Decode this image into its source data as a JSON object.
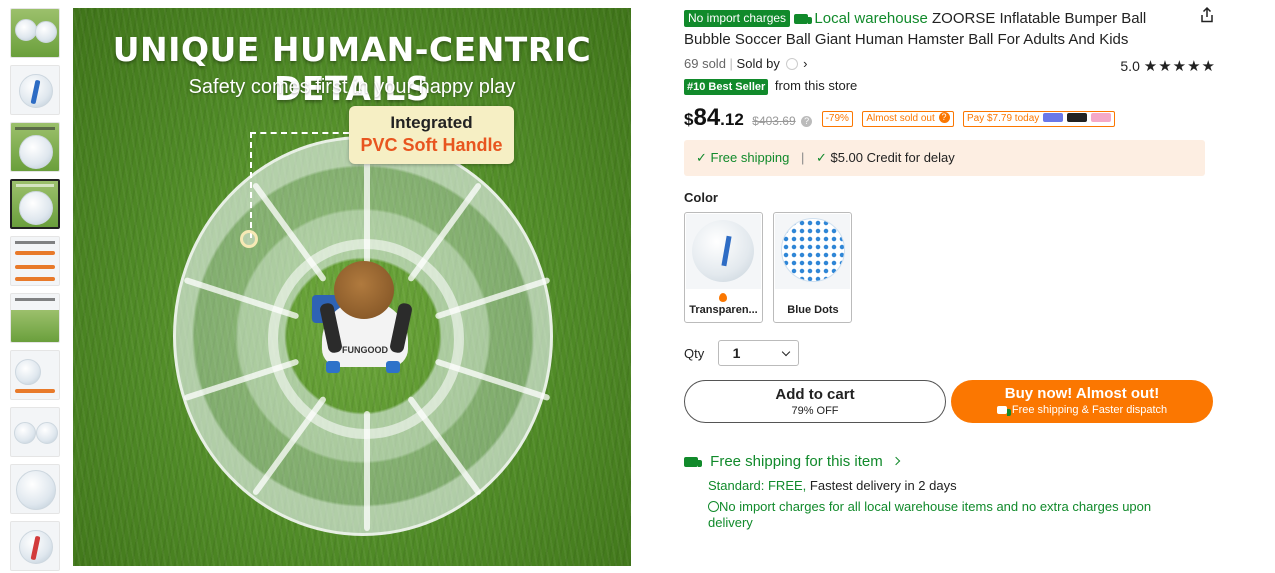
{
  "gallery": {
    "thumbnail_count": 10,
    "active_index": 3,
    "hero_title": "UNIQUE HUMAN-CENTRIC DETAILS",
    "hero_subtitle": "Safety comes first in your happy play",
    "callout_line1": "Integrated",
    "callout_line2": "PVC Soft Handle",
    "shirt_text": "FUNGOOD"
  },
  "product": {
    "badge_no_import": "No import charges",
    "local_warehouse": "Local warehouse",
    "title": "ZOORSE Inflatable Bumper Ball Bubble Soccer Ball Giant Human Hamster Ball For Adults And Kids",
    "sold_count": "69 sold",
    "sold_by": "Sold by",
    "rating": "5.0",
    "stars": "★★★★★",
    "best_seller_badge": "#10 Best Seller",
    "best_seller_suffix": "from this store"
  },
  "price": {
    "currency": "$",
    "dollars": "84",
    "cents": ".12",
    "original": "$403.69",
    "discount": "-79%",
    "almost_sold_out": "Almost sold out",
    "pay_later": "Pay $7.79 today"
  },
  "shipping_box": {
    "free_shipping": "Free shipping",
    "credit": "$5.00 Credit for delay"
  },
  "color": {
    "label": "Color",
    "options": [
      {
        "label": "Transparen..."
      },
      {
        "label": "Blue Dots"
      }
    ]
  },
  "qty": {
    "label": "Qty",
    "value": "1"
  },
  "buttons": {
    "add_to_cart": "Add to cart",
    "add_to_cart_sub": "79% OFF",
    "buy_now": "Buy now! Almost out!",
    "buy_now_sub": "Free shipping & Faster dispatch"
  },
  "shipping_info": {
    "heading": "Free shipping for this item",
    "standard_label": "Standard: FREE,",
    "standard_detail": "Fastest delivery in 2 days",
    "note": "No import charges for all local warehouse items and no extra charges upon delivery"
  },
  "colors": {
    "green": "#118a2b",
    "orange": "#fb7701"
  },
  "icons": [
    "share-icon",
    "truck-icon",
    "chevron-right-icon",
    "star-icon",
    "question-icon",
    "check-icon",
    "chevron-down-icon",
    "fire-icon",
    "circle-icon"
  ]
}
